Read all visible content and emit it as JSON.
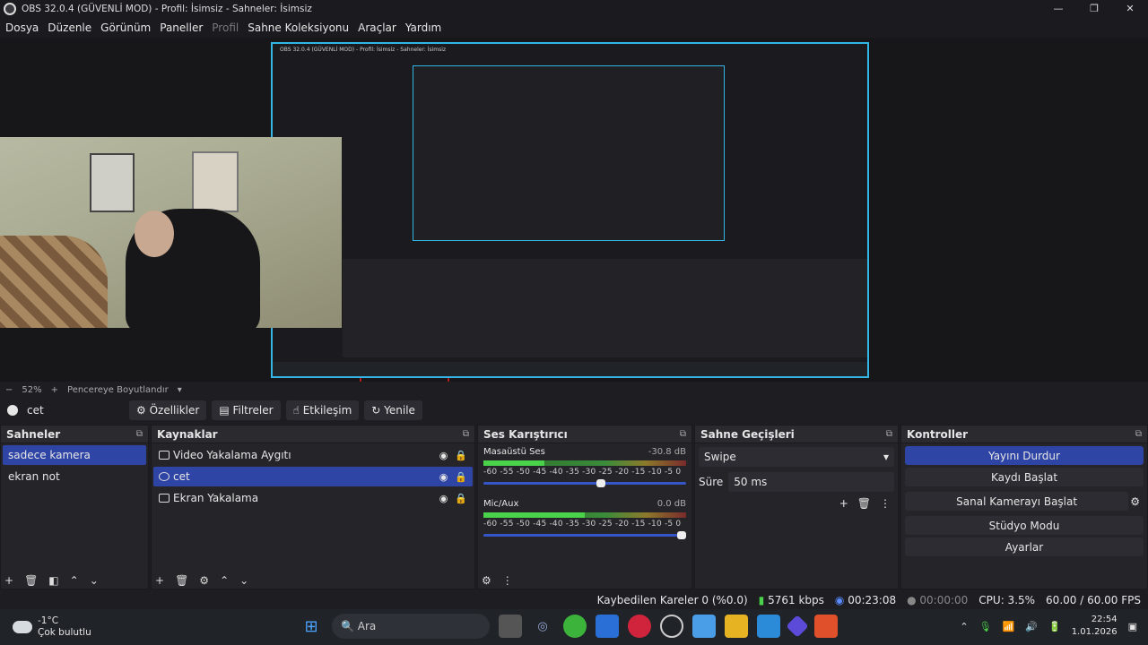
{
  "window": {
    "title": "OBS 32.0.4 (GÜVENLİ MOD) - Profil: İsimsiz - Sahneler: İsimsiz",
    "minimize": "—",
    "maximize": "❐",
    "close": "✕"
  },
  "menu": [
    "Dosya",
    "Düzenle",
    "Görünüm",
    "Paneller",
    "Profil",
    "Sahne Koleksiyonu",
    "Araçlar",
    "Yardım"
  ],
  "zoom": {
    "minus": "−",
    "value": "52%",
    "plus": "+",
    "fit": "Pencereye Boyutlandır",
    "caret": "▾"
  },
  "source_toolbar": {
    "current": "cet",
    "properties": "Özellikler",
    "filters": "Filtreler",
    "interact": "Etkileşim",
    "refresh": "Yenile"
  },
  "scenes": {
    "title": "Sahneler",
    "items": [
      "sadece kamera",
      "ekran not"
    ],
    "selected": 0
  },
  "sources": {
    "title": "Kaynaklar",
    "items": [
      "Video Yakalama Aygıtı",
      "cet",
      "Ekran Yakalama"
    ],
    "selected": 1
  },
  "mixer": {
    "title": "Ses Karıştırıcı",
    "channels": [
      {
        "name": "Masaüstü Ses",
        "db": "-30.8 dB",
        "level": 0.3,
        "volume": 0.6
      },
      {
        "name": "Mic/Aux",
        "db": "0.0 dB",
        "level": 0.5,
        "volume": 1.0
      }
    ],
    "scale": "-60 -55 -50 -45 -40 -35 -30 -25 -20 -15 -10 -5 0"
  },
  "transitions": {
    "title": "Sahne Geçişleri",
    "selected": "Swipe",
    "duration_label": "Süre",
    "duration": "50 ms"
  },
  "controls": {
    "title": "Kontroller",
    "buttons": [
      "Yayını Durdur",
      "Kaydı Başlat",
      "Sanal Kamerayı Başlat",
      "Stüdyo Modu",
      "Ayarlar"
    ]
  },
  "status": {
    "dropped": "Kaybedilen Kareler 0 (%0.0)",
    "bitrate": "5761 kbps",
    "stream_time": "00:23:08",
    "rec_time": "00:00:00",
    "cpu": "CPU: 3.5%",
    "fps": "60.00 / 60.00 FPS"
  },
  "taskbar": {
    "temp": "-1°C",
    "weather": "Çok bulutlu",
    "search": "Ara",
    "time": "22:54",
    "date": "1.01.2026"
  },
  "colors": {
    "accent": "#2f45a5",
    "preview_border": "#33b5e5",
    "guide": "#e02020"
  }
}
